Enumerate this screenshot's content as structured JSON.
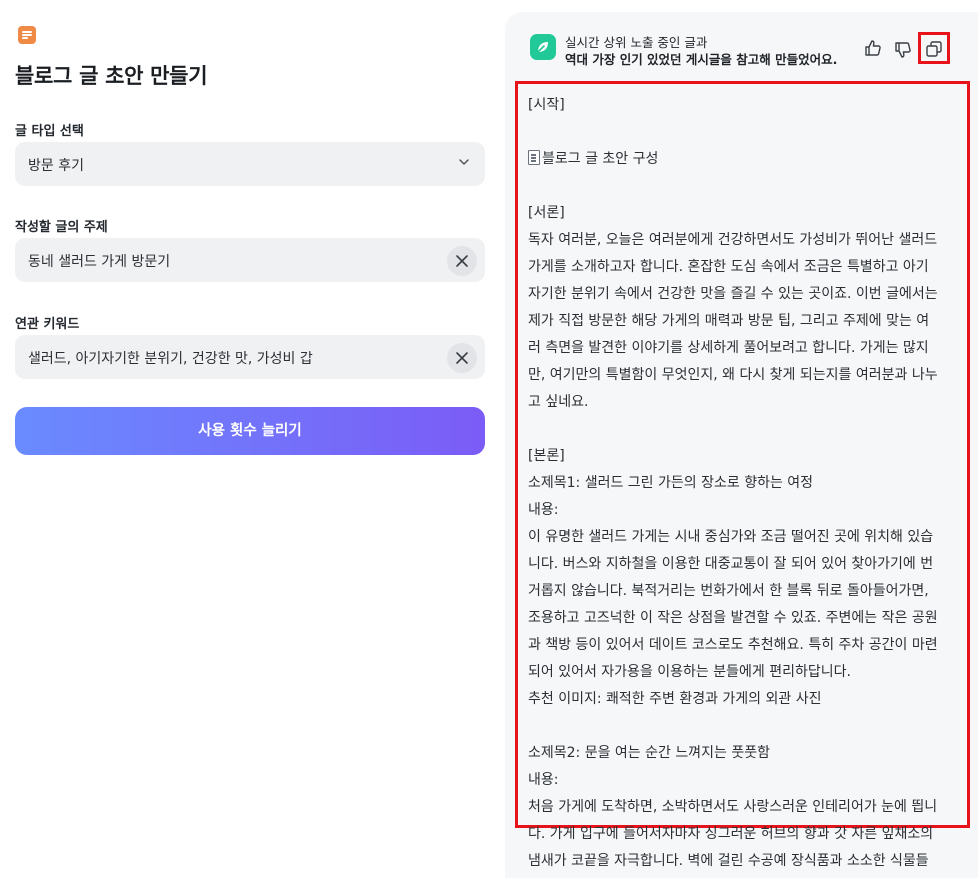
{
  "app": {
    "icon": "document-list-icon",
    "title": "블로그 글 초안 만들기"
  },
  "form": {
    "type_label": "글 타입 선택",
    "type_value": "방문 후기",
    "topic_label": "작성할 글의 주제",
    "topic_value": "동네 샐러드 가게 방문기",
    "keyword_label": "연관 키워드",
    "keyword_value": "샐러드, 아기자기한 분위기, 건강한 맛, 가성비 갑",
    "cta_label": "사용 횟수 늘리기"
  },
  "result": {
    "header_line1": "실시간 상위 노출 중인 글과",
    "header_line2": "역대 가장 인기 있었던 게시글을 참고해 만들었어요.",
    "accent_color": "#20c997",
    "highlight_color": "#e8131a",
    "lines": [
      "[시작]",
      "",
      "블로그 글 초안 구성",
      "",
      "[서론]",
      "독자 여러분, 오늘은 여러분에게 건강하면서도 가성비가 뛰어난 샐러드",
      "가게를 소개하고자 합니다. 혼잡한 도심 속에서 조금은 특별하고 아기",
      "자기한 분위기 속에서 건강한 맛을 즐길 수 있는 곳이죠. 이번 글에서는",
      "제가 직접 방문한 해당 가게의 매력과 방문 팁, 그리고 주제에 맞는 여",
      "러 측면을 발견한 이야기를 상세하게 풀어보려고 합니다. 가게는 많지",
      "만, 여기만의 특별함이 무엇인지, 왜 다시 찾게 되는지를 여러분과 나누",
      "고 싶네요.",
      "",
      "[본론]",
      "소제목1: 샐러드 그린 가든의 장소로 향하는 여정",
      "내용:",
      "이 유명한 샐러드 가게는 시내 중심가와 조금 떨어진 곳에 위치해 있습",
      "니다. 버스와 지하철을 이용한 대중교통이 잘 되어 있어 찾아가기에 번",
      "거롭지 않습니다. 북적거리는 번화가에서 한 블록 뒤로 돌아들어가면,",
      "조용하고 고즈넉한 이 작은 상점을 발견할 수 있죠. 주변에는 작은 공원",
      "과 책방 등이 있어서 데이트 코스로도 추천해요. 특히 주차 공간이 마련",
      "되어 있어서 자가용을 이용하는 분들에게 편리하답니다.",
      "추천 이미지: 쾌적한 주변 환경과 가게의 외관 사진",
      "",
      "소제목2: 문을 여는 순간 느껴지는 풋풋함",
      "내용:",
      "처음 가게에 도착하면, 소박하면서도 사랑스러운 인테리어가 눈에 띕니",
      "다. 가게 입구에 들어서자마자 싱그러운 허브의 향과 갓 자른 잎채소의",
      "냄새가 코끝을 자극합니다. 벽에 걸린 수공예 장식품과 소소한 식물들"
    ]
  }
}
